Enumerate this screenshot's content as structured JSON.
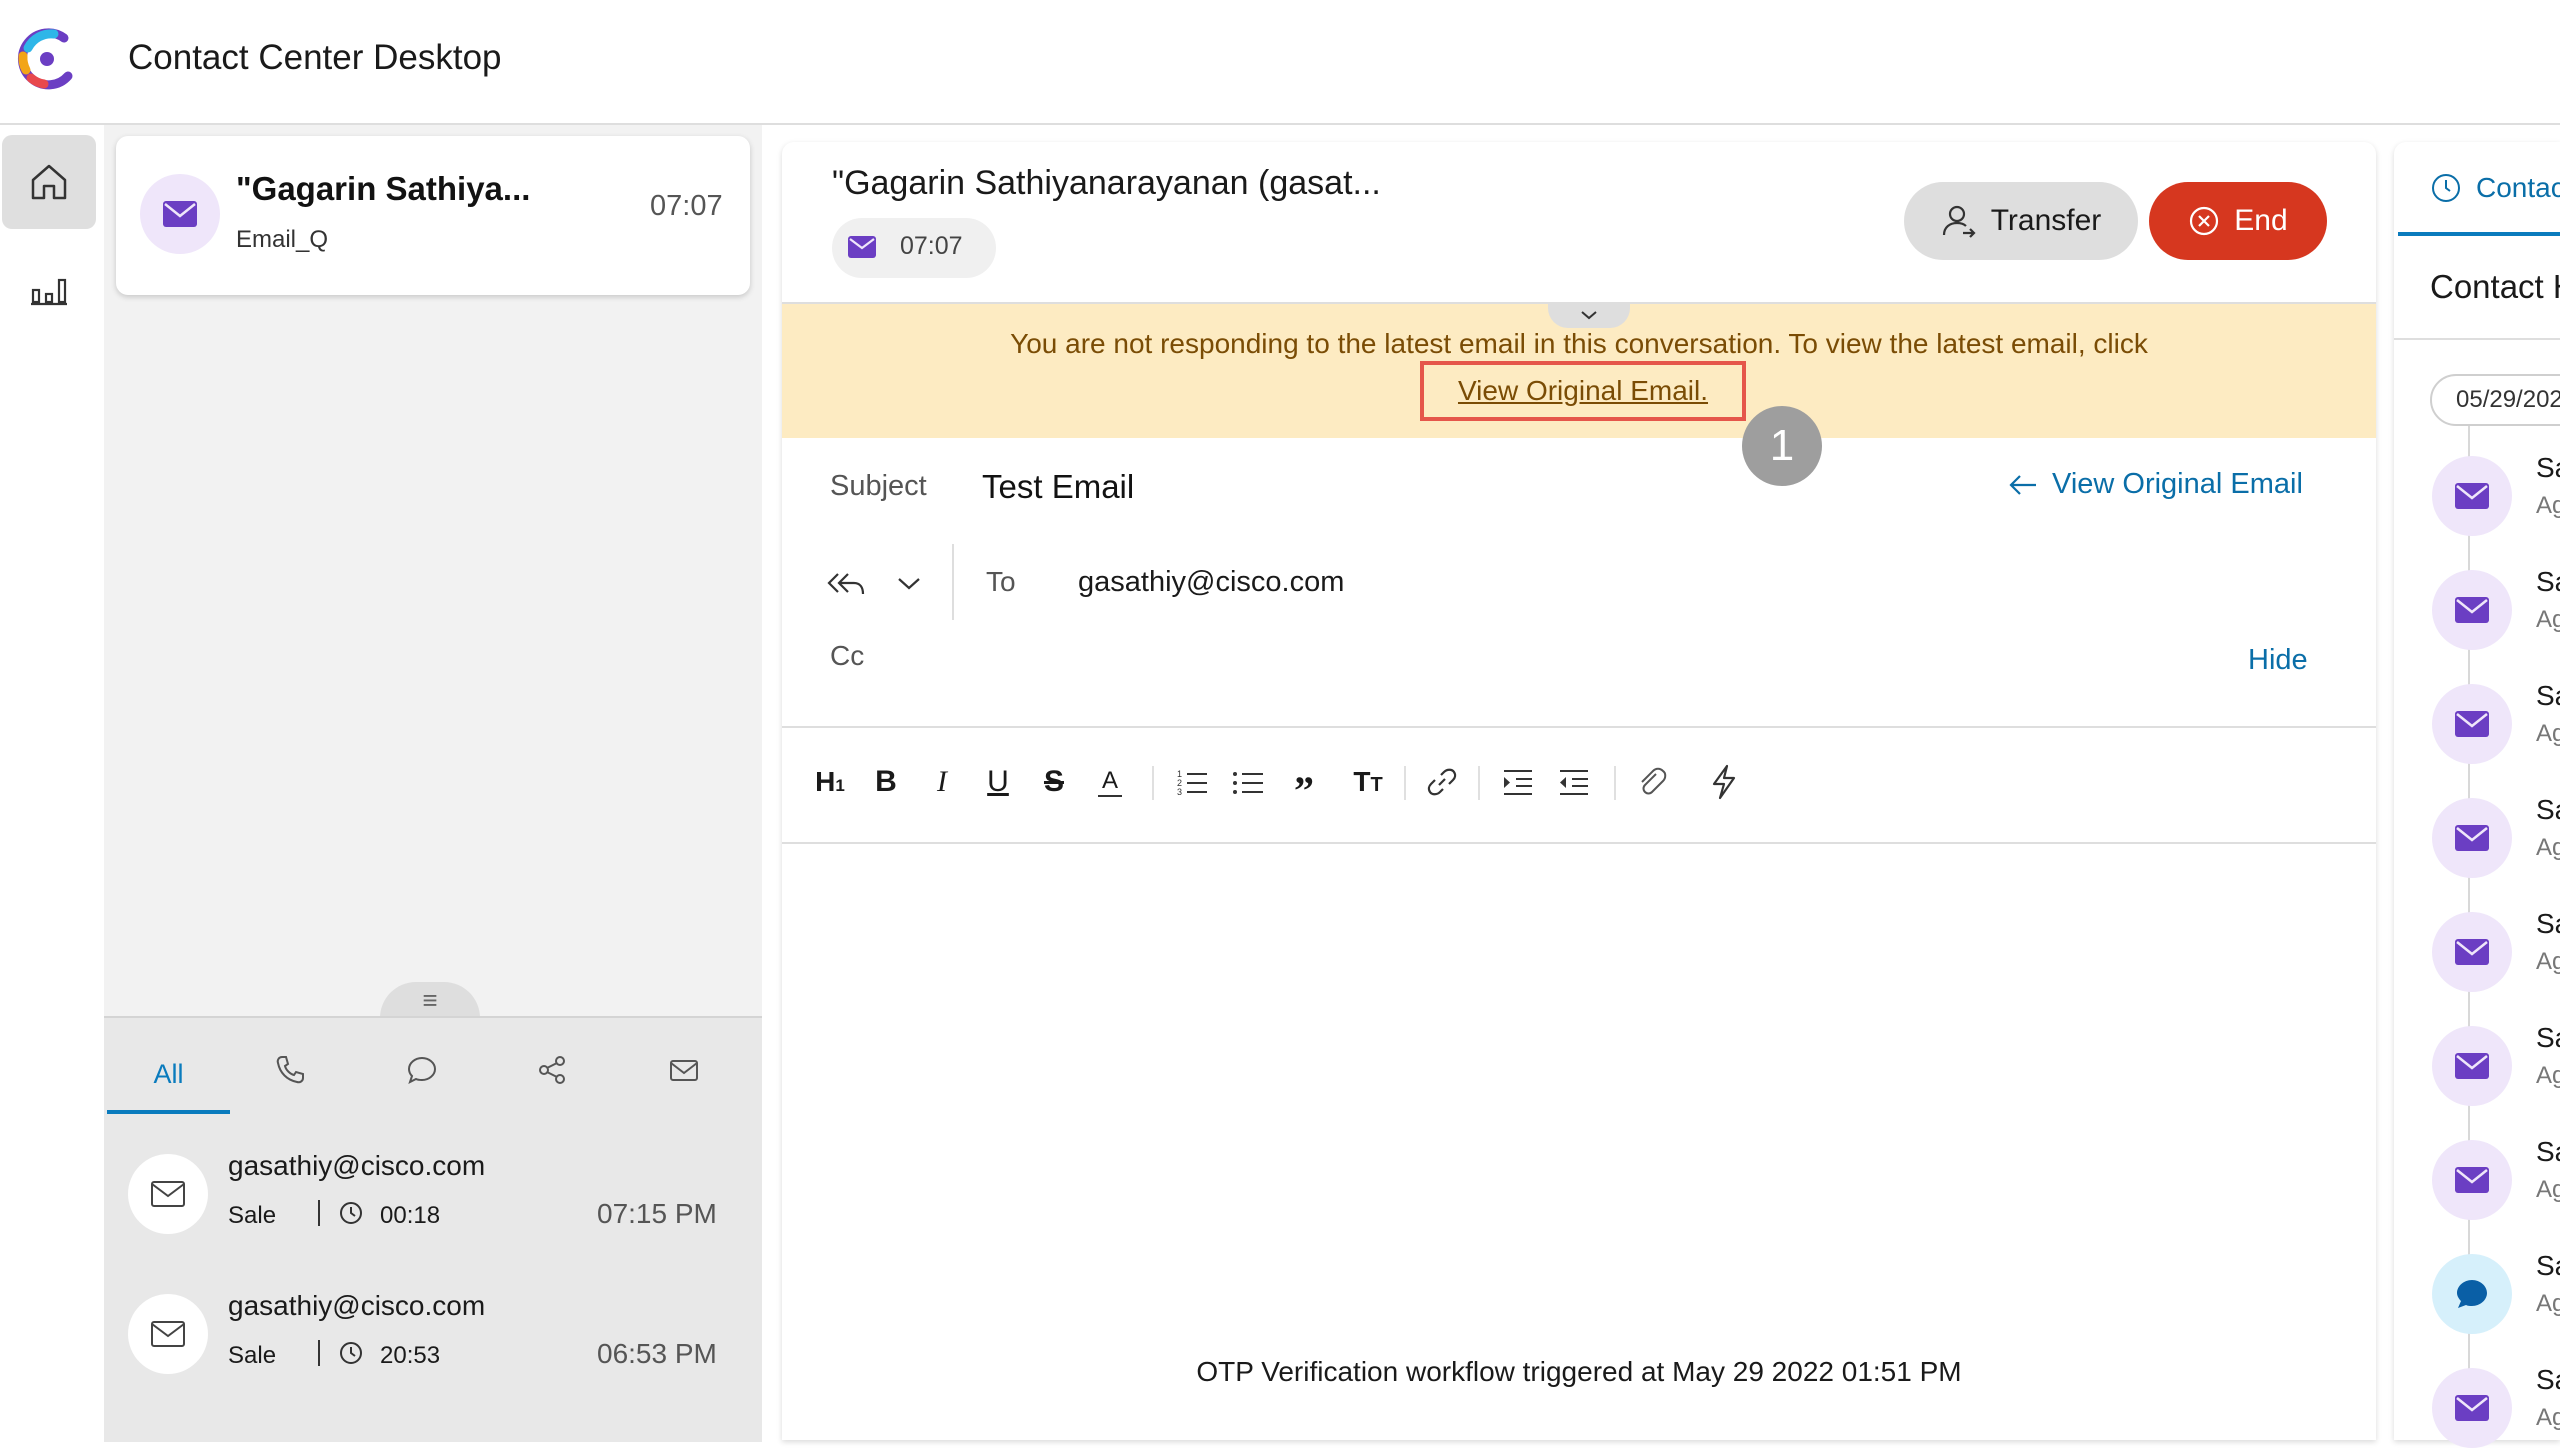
{
  "header": {
    "title": "Contact Center Desktop"
  },
  "task": {
    "name": "\"Gagarin Sathiya...",
    "queue": "Email_Q",
    "time": "07:07"
  },
  "history": {
    "tabs": {
      "all": "All"
    },
    "items": [
      {
        "email": "gasathiy@cisco.com",
        "queue": "Sale",
        "duration": "00:18",
        "time": "07:15 PM"
      },
      {
        "email": "gasathiy@cisco.com",
        "queue": "Sale",
        "duration": "20:53",
        "time": "06:53 PM"
      }
    ]
  },
  "main": {
    "title": "\"Gagarin Sathiyanarayanan (gasat...",
    "timer": "07:07",
    "transfer_label": "Transfer",
    "end_label": "End",
    "banner_text": "You are not responding to the latest email in this conversation. To view the latest email, click",
    "banner_link": "View Original Email.",
    "step_badge": "1",
    "subject_label": "Subject",
    "subject_value": "Test Email",
    "view_original_label": "View Original Email",
    "to_label": "To",
    "to_value": "gasathiy@cisco.com",
    "cc_label": "Cc",
    "hide_label": "Hide",
    "body_text": "OTP Verification workflow triggered at May 29 2022 01:51 PM"
  },
  "toolbar": [
    "heading-icon",
    "bold-icon",
    "italic-icon",
    "underline-icon",
    "strikethrough-icon",
    "font-color-icon",
    "numbered-list-icon",
    "bullet-list-icon",
    "quote-icon",
    "text-size-icon",
    "link-icon",
    "indent-icon",
    "outdent-icon",
    "attachment-icon",
    "quick-reply-icon"
  ],
  "right": {
    "tab_label": "Contac",
    "title": "Contact H",
    "date": "05/29/202",
    "items": [
      {
        "t1": "Sa",
        "t2": "Ag",
        "kind": "email"
      },
      {
        "t1": "Sa",
        "t2": "Ag",
        "kind": "email"
      },
      {
        "t1": "Sa",
        "t2": "Ag",
        "kind": "email"
      },
      {
        "t1": "Sa",
        "t2": "Ag",
        "kind": "email"
      },
      {
        "t1": "Sa",
        "t2": "Ag",
        "kind": "email"
      },
      {
        "t1": "Sa",
        "t2": "Ag",
        "kind": "email"
      },
      {
        "t1": "Sa",
        "t2": "Ag",
        "kind": "email"
      },
      {
        "t1": "Sa",
        "t2": "Ag",
        "kind": "chat"
      },
      {
        "t1": "Sa",
        "t2": "Ag",
        "kind": "email"
      }
    ]
  },
  "colors": {
    "accent": "#0a7bbd",
    "end": "#d6371f",
    "banner": "#fdebc2",
    "email_purple": "#6b3ec3"
  }
}
